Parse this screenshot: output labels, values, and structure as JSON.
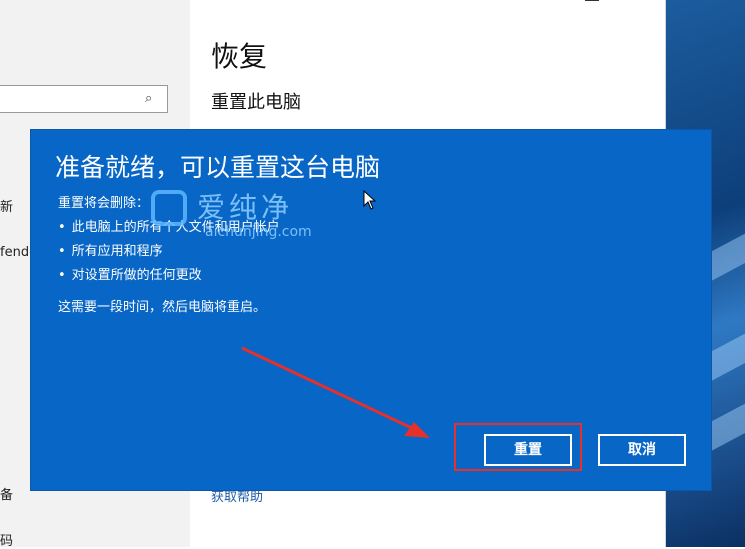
{
  "settings": {
    "page_title": "恢复",
    "section_title": "重置此电脑",
    "side_items": [
      "新",
      "fende",
      "备",
      "码"
    ],
    "help_link": "获取帮助"
  },
  "dialog": {
    "title": "准备就绪，可以重置这台电脑",
    "intro": "重置将会删除：",
    "items": [
      "此电脑上的所有个人文件和用户帐户",
      "所有应用和程序",
      "对设置所做的任何更改"
    ],
    "note": "这需要一段时间，然后电脑将重启。",
    "reset_label": "重置",
    "cancel_label": "取消"
  },
  "watermark": {
    "name": "爱纯净",
    "url": "aichunjing.com"
  },
  "colors": {
    "dialog_bg": "#0766c6",
    "highlight": "#e4312b",
    "arrow": "#e4312b"
  }
}
